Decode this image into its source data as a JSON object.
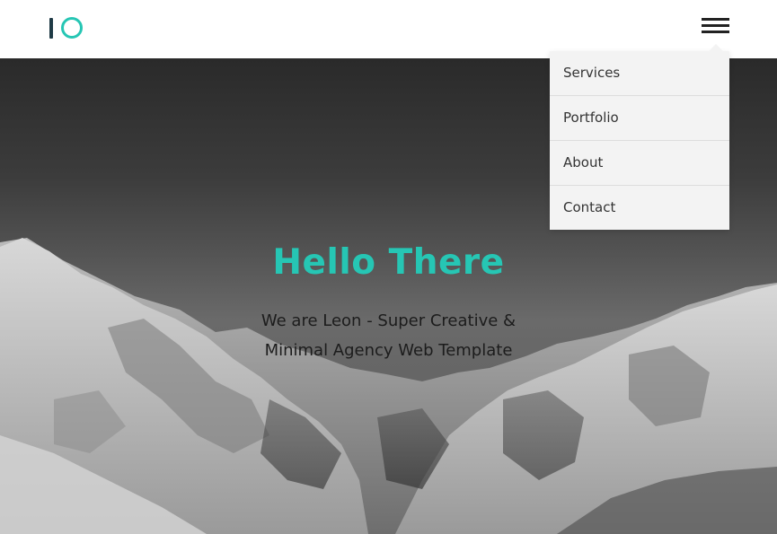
{
  "header": {
    "logo_icon": "io-logo-icon",
    "menu_icon": "hamburger-menu-icon"
  },
  "dropdown": {
    "items": [
      {
        "label": "Services"
      },
      {
        "label": "Portfolio"
      },
      {
        "label": "About"
      },
      {
        "label": "Contact"
      }
    ]
  },
  "hero": {
    "title": "Hello There",
    "subtitle_line1": "We are Leon - Super Creative &",
    "subtitle_line2": "Minimal Agency Web Template",
    "background": "mountain-landscape-image"
  },
  "colors": {
    "accent": "#26c6b4",
    "logo_dark": "#1f3b46",
    "dropdown_bg": "#f3f3f3"
  }
}
